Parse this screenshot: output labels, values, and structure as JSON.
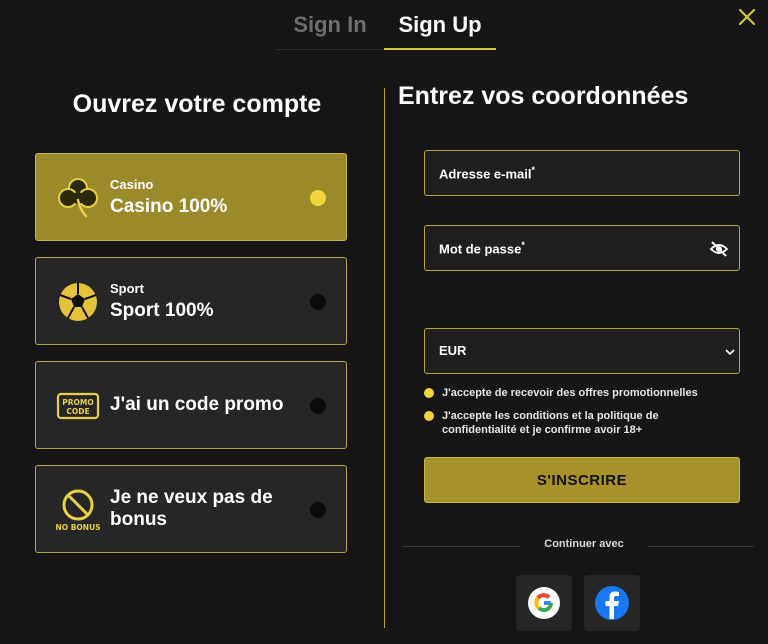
{
  "tabs": {
    "signin": "Sign In",
    "signup": "Sign Up"
  },
  "left": {
    "title": "Ouvrez votre compte",
    "options": [
      {
        "sub": "Casino",
        "main": "Casino 100%",
        "selected": true,
        "icon": "clover-icon"
      },
      {
        "sub": "Sport",
        "main": "Sport 100%",
        "selected": false,
        "icon": "soccer-ball-icon"
      },
      {
        "main": "J'ai un code promo",
        "icon_text": "PROMO CODE",
        "selected": false,
        "icon": "promo-code-icon"
      },
      {
        "main": "Je ne veux pas de bonus",
        "icon_text": "NO BONUS",
        "selected": false,
        "icon": "no-bonus-icon"
      }
    ]
  },
  "right": {
    "title": "Entrez vos coordonnées",
    "email_label": "Adresse e-mail",
    "password_label": "Mot de passe",
    "required_mark": "*",
    "currency": "EUR",
    "checks": [
      "J'accepte de recevoir des offres promotionnelles",
      "J'accepte les conditions et la politique de confidentialité et je confirme avoir 18+"
    ],
    "submit_label": "S'INSCRIRE",
    "continue_with": "Continuer avec",
    "social_icons": [
      "google-icon",
      "facebook-icon"
    ]
  },
  "colors": {
    "accent": "#d6c33a",
    "selected_bg": "#9b8a2a",
    "dot": "#f2d53c",
    "facebook": "#1877f2"
  }
}
